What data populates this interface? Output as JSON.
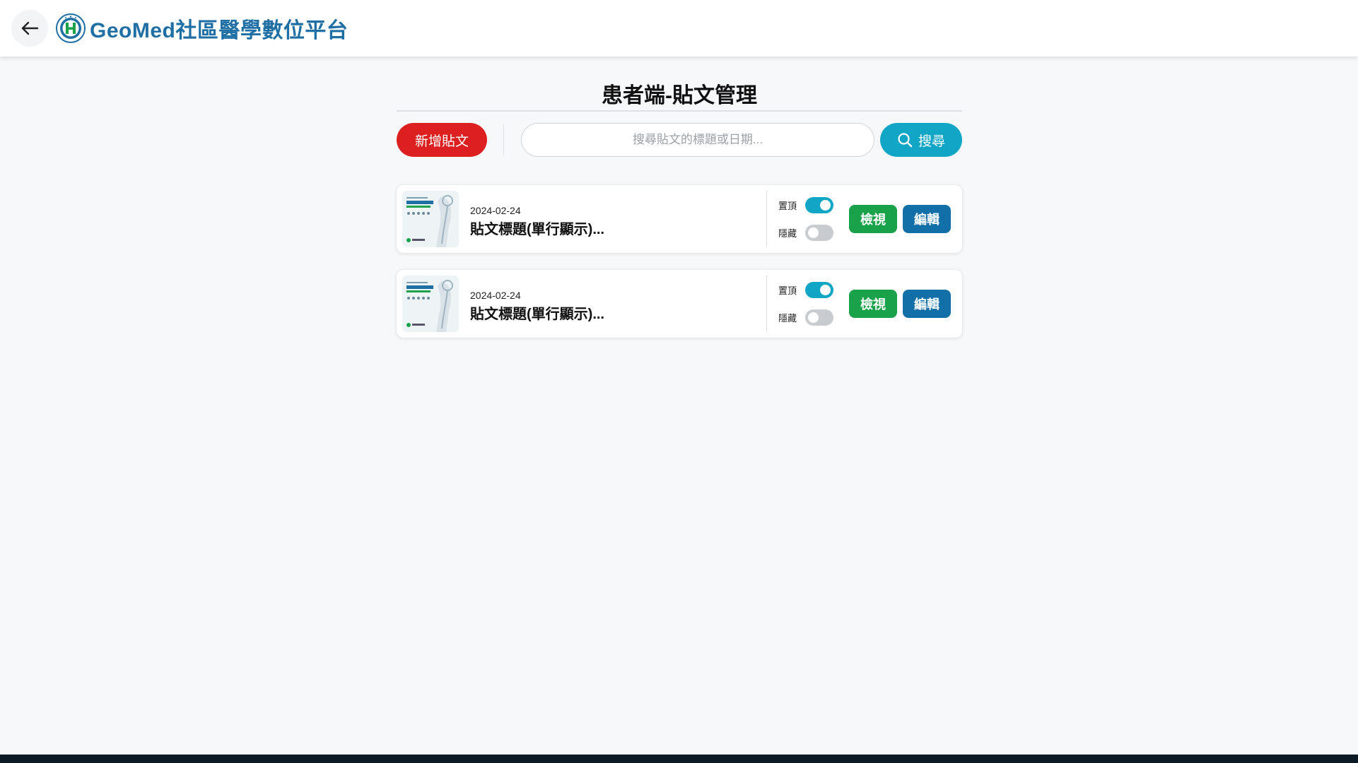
{
  "header": {
    "brand_title": "GeoMed社區醫學數位平台",
    "back_icon": "arrow-left-icon",
    "logo_icon": "geomed-logo"
  },
  "page": {
    "title": "患者端-貼文管理"
  },
  "toolbar": {
    "add_label": "新增貼文",
    "search_placeholder": "搜尋貼文的標題或日期...",
    "search_value": "",
    "search_label": "搜尋",
    "search_icon": "search-icon"
  },
  "posts": [
    {
      "date": "2024-02-24",
      "title": "貼文標題(單行顯示)...",
      "pin_label": "置頂",
      "pin_on": true,
      "hide_label": "隱藏",
      "hide_on": false,
      "view_label": "檢視",
      "edit_label": "編輯"
    },
    {
      "date": "2024-02-24",
      "title": "貼文標題(單行顯示)...",
      "pin_label": "置頂",
      "pin_on": true,
      "hide_label": "隱藏",
      "hide_on": false,
      "view_label": "檢視",
      "edit_label": "編輯"
    }
  ],
  "colors": {
    "brand": "#1f6fa5",
    "add_button": "#dc2020",
    "search_button": "#12a6c6",
    "toggle_on": "#12a6c6",
    "toggle_off": "#c8cbcf",
    "view_button": "#1aa24a",
    "edit_button": "#136fa8"
  }
}
